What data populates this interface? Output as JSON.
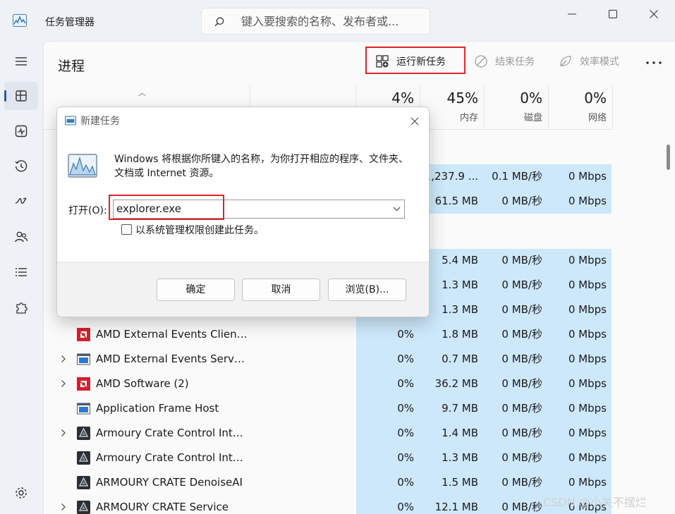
{
  "app": {
    "title": "任务管理器"
  },
  "search": {
    "placeholder": "键入要搜索的名称、发布者或..."
  },
  "nav": [
    "hamburger-menu",
    "processes",
    "performance",
    "app-history",
    "startup-apps",
    "users",
    "details",
    "services",
    "settings"
  ],
  "page": {
    "title": "进程"
  },
  "toolbar": {
    "run_new_task": "运行新任务",
    "end_task": "结束任务",
    "efficiency_mode": "效率模式"
  },
  "columns": [
    {
      "pct": "4%",
      "label": ""
    },
    {
      "pct": "45%",
      "label": "内存"
    },
    {
      "pct": "0%",
      "label": "磁盘"
    },
    {
      "pct": "0%",
      "label": "网络"
    }
  ],
  "partial_rows": [
    {
      "mem": "1,237.9 ...",
      "disk": "0.1 MB/秒",
      "net": "0 Mbps"
    },
    {
      "mem": "61.5 MB",
      "disk": "0 MB/秒",
      "net": "0 Mbps"
    },
    {
      "mem": "5.4 MB",
      "disk": "0 MB/秒",
      "net": "0 Mbps"
    },
    {
      "mem": "1.3 MB",
      "disk": "0 MB/秒",
      "net": "0 Mbps"
    },
    {
      "mem": "1.3 MB",
      "disk": "0 MB/秒",
      "net": "0 Mbps"
    }
  ],
  "rows": [
    {
      "name": "AMD External Events Client...",
      "expand": false,
      "icon": "amd",
      "cpu": "0%",
      "mem": "1.8 MB",
      "disk": "0 MB/秒",
      "net": "0 Mbps"
    },
    {
      "name": "AMD External Events Servic...",
      "expand": true,
      "icon": "window",
      "cpu": "0%",
      "mem": "0.7 MB",
      "disk": "0 MB/秒",
      "net": "0 Mbps"
    },
    {
      "name": "AMD Software (2)",
      "expand": true,
      "icon": "amd",
      "cpu": "0%",
      "mem": "36.2 MB",
      "disk": "0 MB/秒",
      "net": "0 Mbps"
    },
    {
      "name": "Application Frame Host",
      "expand": false,
      "icon": "window",
      "cpu": "0%",
      "mem": "9.7 MB",
      "disk": "0 MB/秒",
      "net": "0 Mbps"
    },
    {
      "name": "Armoury Crate Control Inte...",
      "expand": true,
      "icon": "armoury",
      "cpu": "0%",
      "mem": "1.4 MB",
      "disk": "0 MB/秒",
      "net": "0 Mbps"
    },
    {
      "name": "Armoury Crate Control Inte...",
      "expand": false,
      "icon": "armoury",
      "cpu": "0%",
      "mem": "1.3 MB",
      "disk": "0 MB/秒",
      "net": "0 Mbps"
    },
    {
      "name": "ARMOURY CRATE DenoiseAI",
      "expand": false,
      "icon": "armoury",
      "cpu": "0%",
      "mem": "1.5 MB",
      "disk": "0 MB/秒",
      "net": "0 Mbps"
    },
    {
      "name": "ARMOURY CRATE Service",
      "expand": true,
      "icon": "armoury",
      "cpu": "0%",
      "mem": "12.1 MB",
      "disk": "0 MB/秒",
      "net": "0 Mbps"
    }
  ],
  "dialog": {
    "title": "新建任务",
    "description": "Windows 将根据你所键入的名称，为你打开相应的程序、文件夹、文档或 Internet 资源。",
    "open_label": "打开(O):",
    "open_value": "explorer.exe",
    "admin_checkbox": "以系统管理权限创建此任务。",
    "admin_checked": false,
    "ok": "确定",
    "cancel": "取消",
    "browse": "浏览(B)..."
  },
  "watermark": "CSDN @小关不摆烂",
  "colors": {
    "accent": "#1a5fb4",
    "highlight_red": "#e0232b",
    "cell_blue": "#cde8fb"
  }
}
